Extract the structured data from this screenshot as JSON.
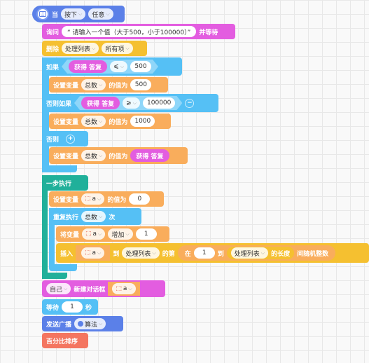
{
  "hat": {
    "label": "当",
    "trigger": "按下",
    "key": "任意",
    "icon": "keyboard-icon"
  },
  "ask": {
    "label": "询问",
    "text": "“ 请输入一个值（大于500，小于100000）”",
    "suffix": "并等待"
  },
  "del": {
    "label": "删除",
    "list": "处理列表",
    "item": "所有项"
  },
  "if1": {
    "label": "如果",
    "answer": "获得 答复",
    "op": "⩽",
    "value": "500"
  },
  "set1": {
    "label": "设置变量",
    "var": "总数",
    "of": "的值为",
    "value": "500"
  },
  "elif": {
    "label": "否则如果",
    "answer": "获得 答复",
    "op": "⩾",
    "value": "100000"
  },
  "set2": {
    "label": "设置变量",
    "var": "总数",
    "of": "的值为",
    "value": "1000"
  },
  "else": {
    "label": "否则"
  },
  "set3": {
    "label": "设置变量",
    "var": "总数",
    "of": "的值为",
    "answer": "获得 答复"
  },
  "step": {
    "label": "一步执行"
  },
  "set4": {
    "label": "设置变量",
    "var": "a",
    "of": "的值为",
    "value": "0"
  },
  "repeat": {
    "label": "重复执行",
    "var": "总数",
    "suffix": "次"
  },
  "change": {
    "label": "将变量",
    "var": "a",
    "op": "增加",
    "value": "1"
  },
  "insert": {
    "label": "插入",
    "var": "a",
    "to": "到",
    "list": "处理列表",
    "pos": "的第",
    "between": "在",
    "from": "1",
    "and": "到",
    "list2": "处理列表",
    "len": "的长度",
    "rand": "间随机整数"
  },
  "dialog": {
    "actor": "自己",
    "label": "新建对话框",
    "var": "a"
  },
  "wait": {
    "label": "等待",
    "value": "1",
    "unit": "秒"
  },
  "broadcast": {
    "label": "发送广播",
    "msg": "算法"
  },
  "sort": {
    "label": "百分比排序"
  },
  "colors": {
    "event": "#5b80e8",
    "look": "#e35de0",
    "list": "#f5c030",
    "ctrl": "#55c0f5",
    "var": "#f9ad5c",
    "async": "#20b09a",
    "sort": "#f47560"
  }
}
